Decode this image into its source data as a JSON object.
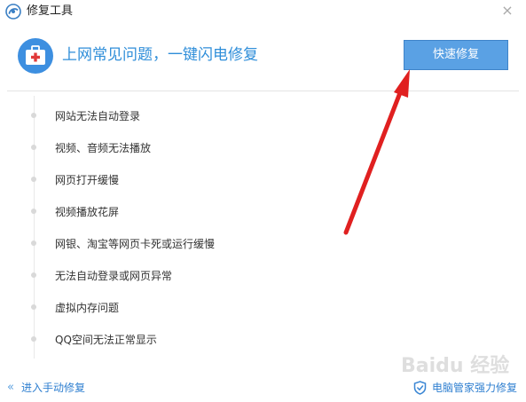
{
  "window": {
    "title": "修复工具",
    "close_glyph": "×"
  },
  "header": {
    "headline": "上网常见问题，一键闪电修复",
    "fix_button_label": "快速修复"
  },
  "issues": [
    "网站无法自动登录",
    "视频、音频无法播放",
    "网页打开缓慢",
    "视频播放花屏",
    "网银、淘宝等网页卡死或运行缓慢",
    "无法自动登录或网页异常",
    "虚拟内存问题",
    "QQ空间无法正常显示"
  ],
  "footer": {
    "left_chevron": "«",
    "left_link": "进入手动修复",
    "right_link": "电脑管家强力修复"
  },
  "watermark": {
    "text": "Baidu 经验"
  },
  "colors": {
    "accent": "#2f8ed9",
    "button": "#5aa1e4",
    "arrow": "#e02020"
  },
  "icons": {
    "app_logo": "qq-pc-manager-logo-icon",
    "header": "first-aid-kit-icon",
    "footer_shield": "shield-icon"
  }
}
